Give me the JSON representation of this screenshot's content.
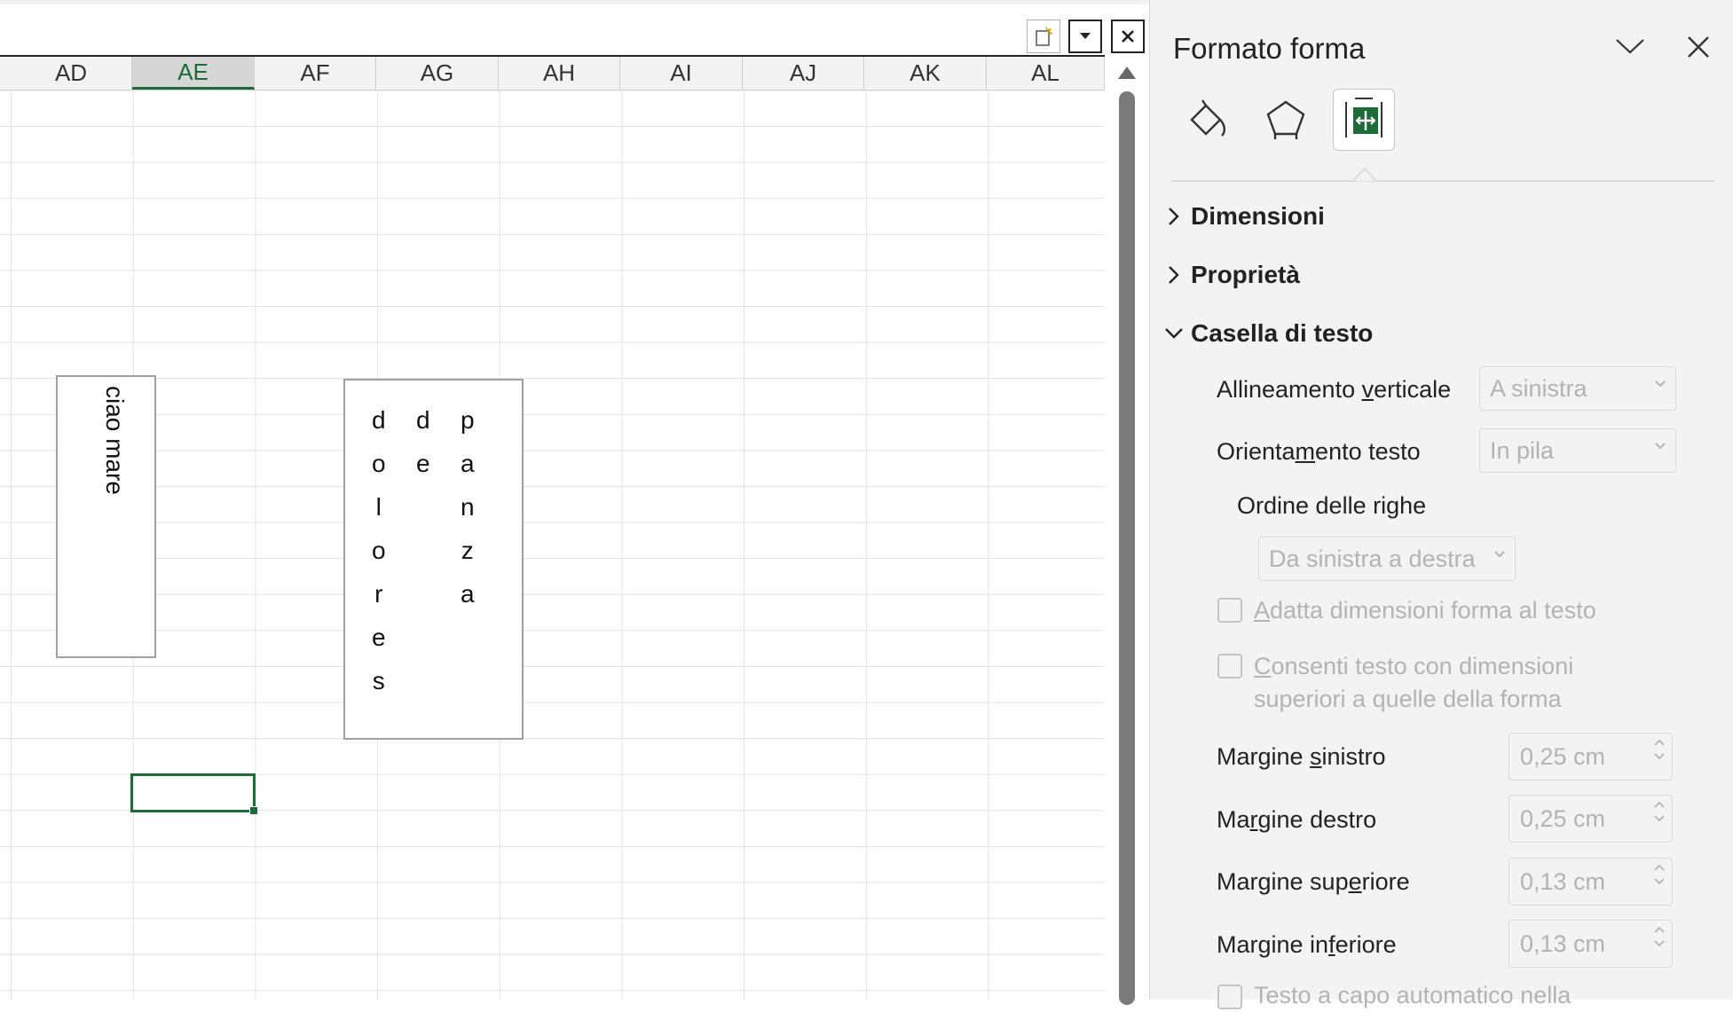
{
  "sheet": {
    "columns": [
      "AD",
      "AE",
      "AF",
      "AG",
      "AH",
      "AI",
      "AJ",
      "AK",
      "AL"
    ],
    "selected_column": "AE",
    "shape1_text": "ciao mare",
    "shape2_columns": [
      [
        "d",
        "o",
        "l",
        "o",
        "r",
        "e",
        "s"
      ],
      [
        "d",
        "e"
      ],
      [
        "p",
        "a",
        "n",
        "z",
        "a"
      ]
    ],
    "toolbar_icons": [
      "new-window-icon",
      "dropdown-icon",
      "close-icon"
    ]
  },
  "pane": {
    "title": "Formato forma",
    "tabs": [
      "fill-line-icon",
      "effects-icon",
      "size-properties-icon"
    ],
    "sections": {
      "dimensioni": "Dimensioni",
      "proprieta": "Proprietà",
      "casella": "Casella di testo"
    },
    "vertical_alignment": {
      "label_pre": "Allineamento ",
      "label_u": "v",
      "label_post": "erticale",
      "value": "A sinistra"
    },
    "text_orientation": {
      "label_pre": "Orienta",
      "label_u": "m",
      "label_post": "ento testo",
      "value": "In pila"
    },
    "line_order": {
      "label": "Ordine delle righe",
      "value": "Da sinistra a destra"
    },
    "fit_shape": {
      "u": "A",
      "rest": "datta dimensioni forma al testo",
      "checked": false
    },
    "allow_overflow": {
      "u": "C",
      "line1_rest": "onsenti testo con dimensioni",
      "line2": "superiori a quelle della forma",
      "checked": false
    },
    "margins": [
      {
        "pre": "Margine ",
        "u": "s",
        "post": "inistro",
        "value": "0,25 cm"
      },
      {
        "pre": "Ma",
        "u": "r",
        "post": "gine destro",
        "value": "0,25 cm"
      },
      {
        "pre": "Margine sup",
        "u": "e",
        "post": "riore",
        "value": "0,13 cm"
      },
      {
        "pre": "Margine in",
        "u": "f",
        "post": "eriore",
        "value": "0,13 cm"
      }
    ],
    "wrap_text_partial": "Testo a capo automatico nella",
    "colors": {
      "accent": "#1e6b3a",
      "disabled_text": "#b3b3b3"
    }
  }
}
